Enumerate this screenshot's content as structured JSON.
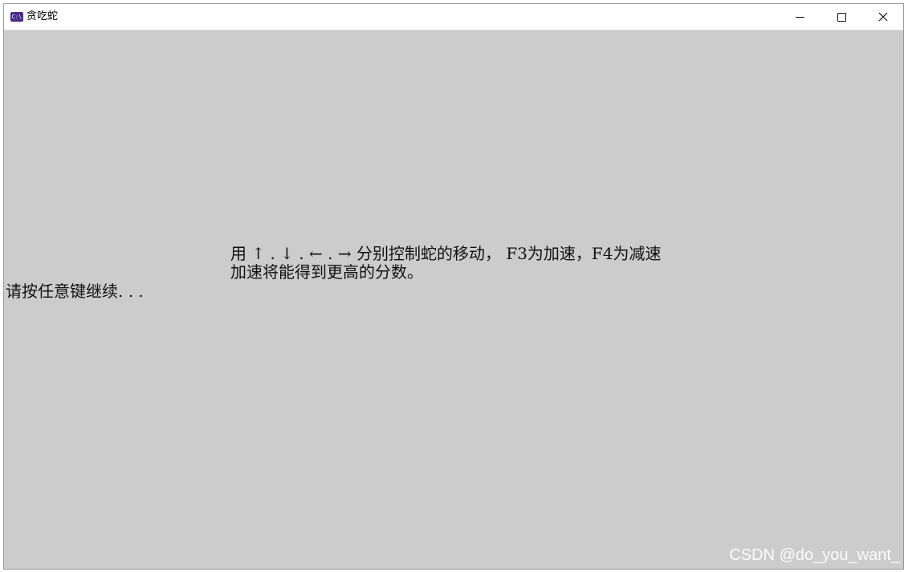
{
  "window": {
    "title": "贪吃蛇",
    "icon": "console-app-icon",
    "icon_text": "C:\\",
    "controls": {
      "minimize": "minimize-icon",
      "maximize": "maximize-icon",
      "close": "close-icon"
    }
  },
  "console": {
    "background_color": "#cccccc",
    "text_color": "#111111",
    "instruction_line_1": "用 ↑ . ↓ . ← . → 分别控制蛇的移动， F3为加速，F4为减速",
    "instruction_line_2": "加速将能得到更高的分数。",
    "pause_prompt": "请按任意键继续. . ."
  },
  "watermark": {
    "text": "CSDN @do_you_want_"
  }
}
